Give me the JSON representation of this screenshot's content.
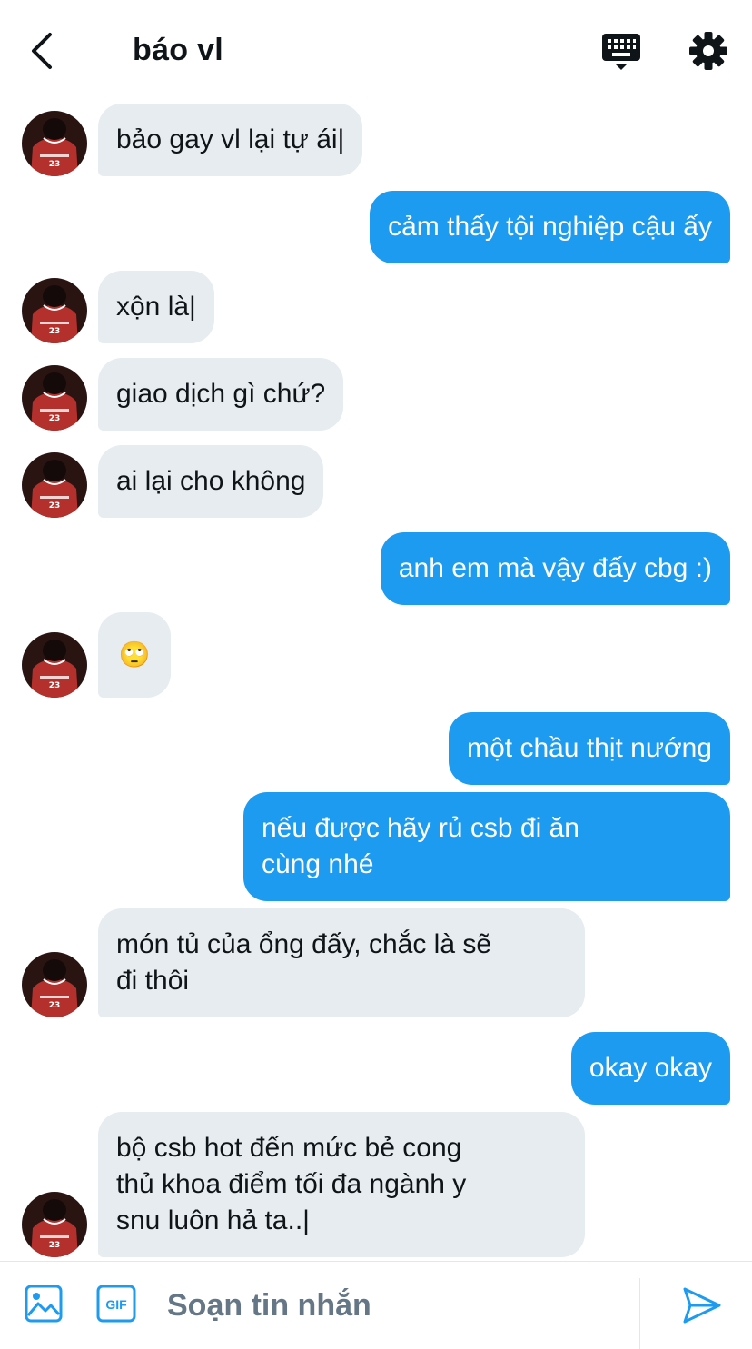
{
  "header": {
    "title": "báo vl",
    "back_icon": "chevron-left-icon",
    "keyboard_icon": "keyboard-icon",
    "settings_icon": "gear-icon"
  },
  "colors": {
    "accent": "#1d9bf0",
    "incoming_bubble": "#e6ecf0",
    "text": "#0f1419",
    "muted": "#657786"
  },
  "messages": [
    {
      "from": "them",
      "text": "bảo gay vl lại tự ái|"
    },
    {
      "from": "me",
      "text": "cảm thấy tội nghiệp cậu ấy"
    },
    {
      "from": "them",
      "text": "xộn là|"
    },
    {
      "from": "them",
      "text": "giao dịch gì chứ?"
    },
    {
      "from": "them",
      "text": "ai lại cho không"
    },
    {
      "from": "me",
      "text": "anh em mà vậy đấy cbg :)"
    },
    {
      "from": "them",
      "text": "🙄"
    },
    {
      "from": "me",
      "text": "một chầu thịt nướng"
    },
    {
      "from": "me",
      "text": "nếu được hãy rủ csb đi ăn\ncùng nhé"
    },
    {
      "from": "them",
      "text": "món tủ của ổng đấy, chắc là sẽ\nđi thôi"
    },
    {
      "from": "me",
      "text": "okay okay"
    },
    {
      "from": "them",
      "text": "bộ csb hot đến mức bẻ cong\nthủ khoa điểm tối đa ngành y\nsnu luôn hả ta..|"
    }
  ],
  "composer": {
    "placeholder": "Soạn tin nhắn",
    "image_icon": "image-icon",
    "gif_icon": "gif-icon",
    "gif_label": "GIF",
    "send_icon": "send-icon"
  }
}
